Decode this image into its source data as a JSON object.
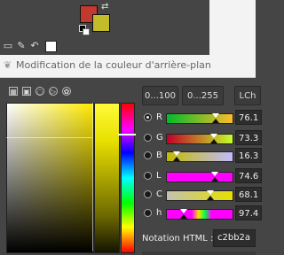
{
  "toolbox": {
    "foreground_color": "#c23a2f",
    "background_color": "#c2bb2a",
    "tool_icons": [
      "device-icon",
      "paths-icon",
      "undo-icon"
    ]
  },
  "dialog": {
    "title": "Modification de la couleur d'arrière-plan",
    "selector_icons": [
      "gimp-selector-icon",
      "cmyk-selector-icon",
      "wheel-selector-icon",
      "triangle-selector-icon",
      "watercolor-selector-icon"
    ],
    "range_buttons": [
      "0...100",
      "0...255",
      "LCh"
    ],
    "channels": [
      {
        "label": "R",
        "value": "76.1",
        "selected": true,
        "fraction": 0.761
      },
      {
        "label": "G",
        "value": "73.3",
        "selected": false,
        "fraction": 0.733
      },
      {
        "label": "B",
        "value": "16.3",
        "selected": false,
        "fraction": 0.163
      },
      {
        "label": "L",
        "value": "74.6",
        "selected": false,
        "fraction": 0.746
      },
      {
        "label": "C",
        "value": "68.1",
        "selected": false,
        "fraction": 0.681
      },
      {
        "label": "h",
        "value": "97.4",
        "selected": false,
        "fraction": 0.271
      }
    ],
    "html_notation": {
      "label": "Notation HTML :",
      "value": "c2bb2a"
    }
  }
}
